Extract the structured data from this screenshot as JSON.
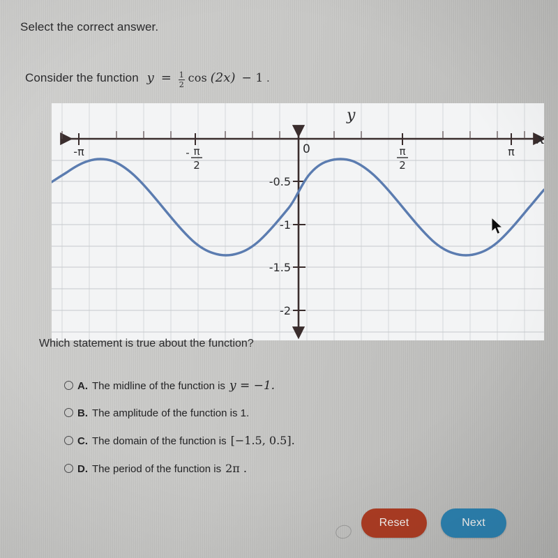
{
  "instruction": "Select the correct answer.",
  "problem": {
    "lead_in": "Consider the function",
    "function_y": "y",
    "function_equals": "=",
    "function_frac_num": "1",
    "function_frac_den": "2",
    "function_cos": "cos",
    "function_arg": "(2x)",
    "function_minus": "− 1",
    "function_full": "y = 1/2 cos(2x) − 1",
    "trailing_period": "."
  },
  "question": "Which statement is true about the function?",
  "options": [
    {
      "letter": "A.",
      "text": "The midline of the function is",
      "math": "y  =  −1.",
      "selected": false
    },
    {
      "letter": "B.",
      "text": "The amplitude of the function is 1.",
      "math": "",
      "selected": false
    },
    {
      "letter": "C.",
      "text": "The domain of the function is",
      "math": "[−1.5, 0.5].",
      "selected": false
    },
    {
      "letter": "D.",
      "text": "The period of the function is",
      "math": "2π .",
      "selected": false
    }
  ],
  "buttons": {
    "reset_label": "Reset",
    "reset_color": "#ab3c23",
    "next_label": "Next",
    "next_color": "#2c80ae"
  },
  "chart_data": {
    "type": "line",
    "title": "",
    "xlabel": "x",
    "ylabel": "y",
    "function": "y = 0.5*cos(2x) - 1",
    "amplitude": 0.5,
    "midline": -1,
    "period": "π",
    "xlim": [
      -4.2,
      4.2
    ],
    "ylim": [
      -2.35,
      0.28
    ],
    "grid": true,
    "legend": null,
    "curve_color": "#5b7cb0",
    "axis_color": "#3a2d2d",
    "grid_color": "#b9bcc0",
    "x_ticks": [
      {
        "value": -3.14159,
        "label": "-π",
        "type": "pi"
      },
      {
        "value": -1.5708,
        "label": "-π/2",
        "type": "pi-half-neg"
      },
      {
        "value": 0,
        "label": "0",
        "type": "zero"
      },
      {
        "value": 1.5708,
        "label": "π/2",
        "type": "pi-half"
      },
      {
        "value": 3.14159,
        "label": "π",
        "type": "pi"
      }
    ],
    "y_ticks": [
      {
        "value": -0.5,
        "label": "-0.5"
      },
      {
        "value": -1,
        "label": "-1"
      },
      {
        "value": -1.5,
        "label": "-1.5"
      },
      {
        "value": -2,
        "label": "-2"
      }
    ],
    "key_points": [
      {
        "x": -3.14159,
        "y": -0.5,
        "kind": "maximum"
      },
      {
        "x": -1.5708,
        "y": -1.5,
        "kind": "minimum"
      },
      {
        "x": 0,
        "y": -0.5,
        "kind": "maximum"
      },
      {
        "x": 1.5708,
        "y": -1.5,
        "kind": "minimum"
      },
      {
        "x": 3.14159,
        "y": -0.5,
        "kind": "maximum"
      }
    ]
  }
}
